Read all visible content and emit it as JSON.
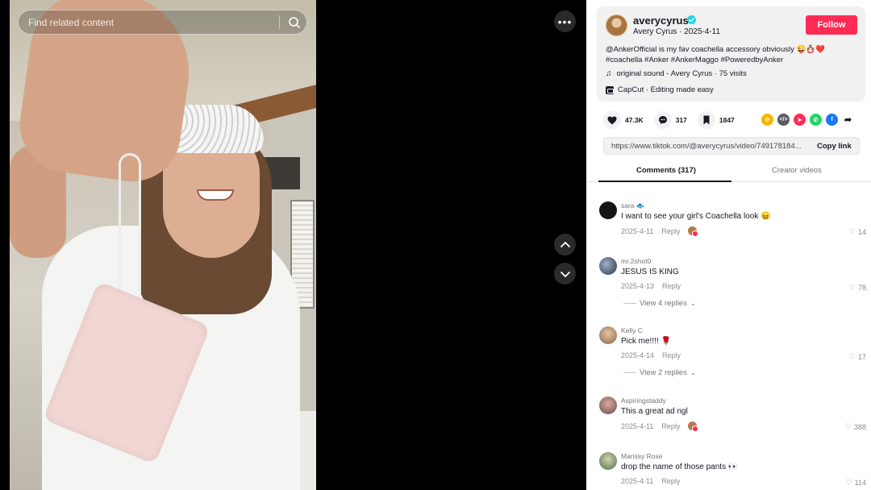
{
  "search": {
    "placeholder": "Find related content"
  },
  "author": {
    "username": "averycyrus",
    "display_name": "Avery Cyrus",
    "date": "2025-4-11",
    "follow_label": "Follow"
  },
  "caption": {
    "line1": "@AnkerOfficial is my fav coachella accessory obviously 😜🪆❤️",
    "line2": "#coachella #Anker #AnkerMaggo #PoweredbyAnker"
  },
  "sound": {
    "label": "original sound - Avery Cyrus · 75 visits"
  },
  "capcut": {
    "label": "CapCut · Editing made easy"
  },
  "stats": {
    "likes": "47.3K",
    "comments": "317",
    "saves": "1847"
  },
  "link": {
    "url": "https://www.tiktok.com/@averycyrus/video/749178184...",
    "copy_label": "Copy link"
  },
  "tabs": {
    "comments": "Comments (317)",
    "creator": "Creator videos"
  },
  "comments": [
    {
      "user": "sara 🐟",
      "text": "I want to see your girl's Coachella look 😖",
      "date": "2025-4-11",
      "reply": "Reply",
      "likes": "14"
    },
    {
      "user": "mr.2shot0",
      "text": "JESUS IS KING",
      "date": "2025-4-13",
      "reply": "Reply",
      "likes": "78",
      "view_replies": "View 4 replies"
    },
    {
      "user": "Kelly C",
      "text": "Pick me!!!! 🌹",
      "date": "2025-4-14",
      "reply": "Reply",
      "likes": "17",
      "view_replies": "View 2 replies"
    },
    {
      "user": "Aspiringstaddy",
      "text": "This a great ad ngl",
      "date": "2025-4-11",
      "reply": "Reply",
      "likes": "388"
    },
    {
      "user": "Marissy Rose",
      "text": "drop the name of those pants 👀",
      "date": "2025-4-11",
      "reply": "Reply",
      "likes": "114"
    }
  ],
  "colors": {
    "accent": "#fe2c55",
    "verified": "#20d5ec"
  }
}
